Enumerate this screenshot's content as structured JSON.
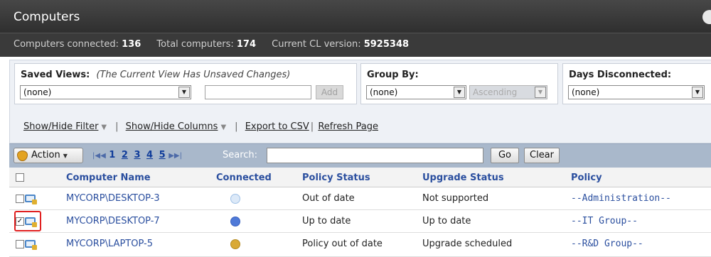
{
  "window": {
    "title": "Computers"
  },
  "stats": {
    "connected_label": "Computers connected:",
    "connected_value": "136",
    "total_label": "Total computers:",
    "total_value": "174",
    "cl_label": "Current CL version:",
    "cl_value": "5925348"
  },
  "saved_views": {
    "label": "Saved Views:",
    "note": "(The Current View Has Unsaved Changes)",
    "selected": "(none)",
    "name_value": "",
    "add_label": "Add"
  },
  "group_by": {
    "label": "Group By:",
    "selected": "(none)",
    "order_selected": "Ascending"
  },
  "days_disconnected": {
    "label": "Days Disconnected:",
    "selected": "(none)"
  },
  "links": {
    "show_hide_filter": "Show/Hide Filter",
    "show_hide_columns": "Show/Hide Columns",
    "export_csv": "Export to CSV",
    "refresh": "Refresh Page"
  },
  "toolbar": {
    "action_label": "Action",
    "pages": [
      "1",
      "2",
      "3",
      "4",
      "5"
    ],
    "current_page": "1",
    "search_label": "Search:",
    "search_value": "",
    "go_label": "Go",
    "clear_label": "Clear"
  },
  "table": {
    "columns": [
      "Computer Name",
      "Connected",
      "Policy Status",
      "Upgrade Status",
      "Policy"
    ],
    "rows": [
      {
        "checked": false,
        "name": "MYCORP\\DESKTOP-3",
        "connected": "disconnected",
        "policy_status": "Out of date",
        "upgrade_status": "Not supported",
        "policy": "--Administration--"
      },
      {
        "checked": true,
        "name": "MYCORP\\DESKTOP-7",
        "connected": "connected",
        "policy_status": "Up to date",
        "upgrade_status": "Up to date",
        "policy": "--IT Group--"
      },
      {
        "checked": false,
        "name": "MYCORP\\LAPTOP-5",
        "connected": "partial",
        "policy_status": "Policy out of date",
        "upgrade_status": "Upgrade scheduled",
        "policy": "--R&D Group--"
      }
    ]
  },
  "colors": {
    "titlebar": "#3a3a3a",
    "toolbar": "#a9b8cb",
    "link_blue": "#2b4f9f",
    "status_connected": "#4f7ad8",
    "status_disconnected": "#d6e6f7",
    "status_partial": "#d9a935",
    "highlight": "#e02020"
  },
  "icons": {
    "action": "shield-icon",
    "row": "computer-icon",
    "pager": [
      "first-page-icon",
      "prev-page-icon",
      "next-page-icon",
      "last-page-icon"
    ]
  }
}
